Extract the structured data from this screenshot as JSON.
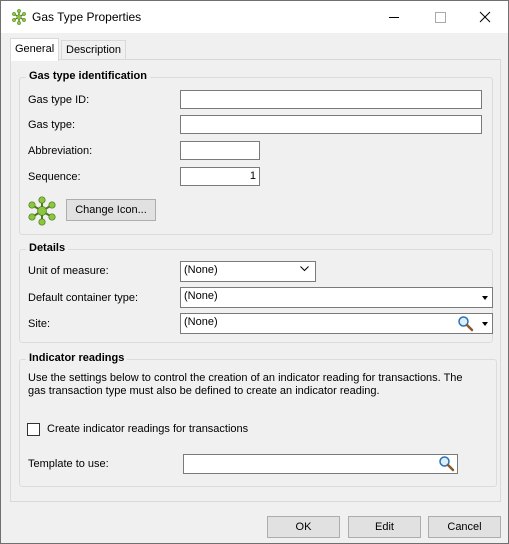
{
  "window": {
    "title": "Gas Type Properties"
  },
  "tabs": [
    {
      "label": "General"
    },
    {
      "label": "Description"
    }
  ],
  "identification": {
    "legend": "Gas type identification",
    "gas_type_id_label": "Gas type ID:",
    "gas_type_id_value": "",
    "gas_type_label": "Gas type:",
    "gas_type_value": "",
    "abbreviation_label": "Abbreviation:",
    "abbreviation_value": "",
    "sequence_label": "Sequence:",
    "sequence_value": "1",
    "change_icon_label": "Change Icon..."
  },
  "details": {
    "legend": "Details",
    "unit_label": "Unit of measure:",
    "unit_value": "(None)",
    "container_label": "Default container type:",
    "container_value": "(None)",
    "site_label": "Site:",
    "site_value": "(None)"
  },
  "indicator": {
    "legend": "Indicator readings",
    "description_line1": "Use the settings below to control the creation of an indicator reading  for  transactions.  The",
    "description_line2": "gas transaction type must also be defined to create an indicator reading.",
    "checkbox_label": "Create indicator readings for transactions",
    "checkbox_checked": false,
    "template_label": "Template to use:",
    "template_value": ""
  },
  "footer": {
    "ok": "OK",
    "edit": "Edit",
    "cancel": "Cancel"
  },
  "colors": {
    "icon_green": "#8cc63f",
    "icon_dark": "#4a7a1a"
  }
}
